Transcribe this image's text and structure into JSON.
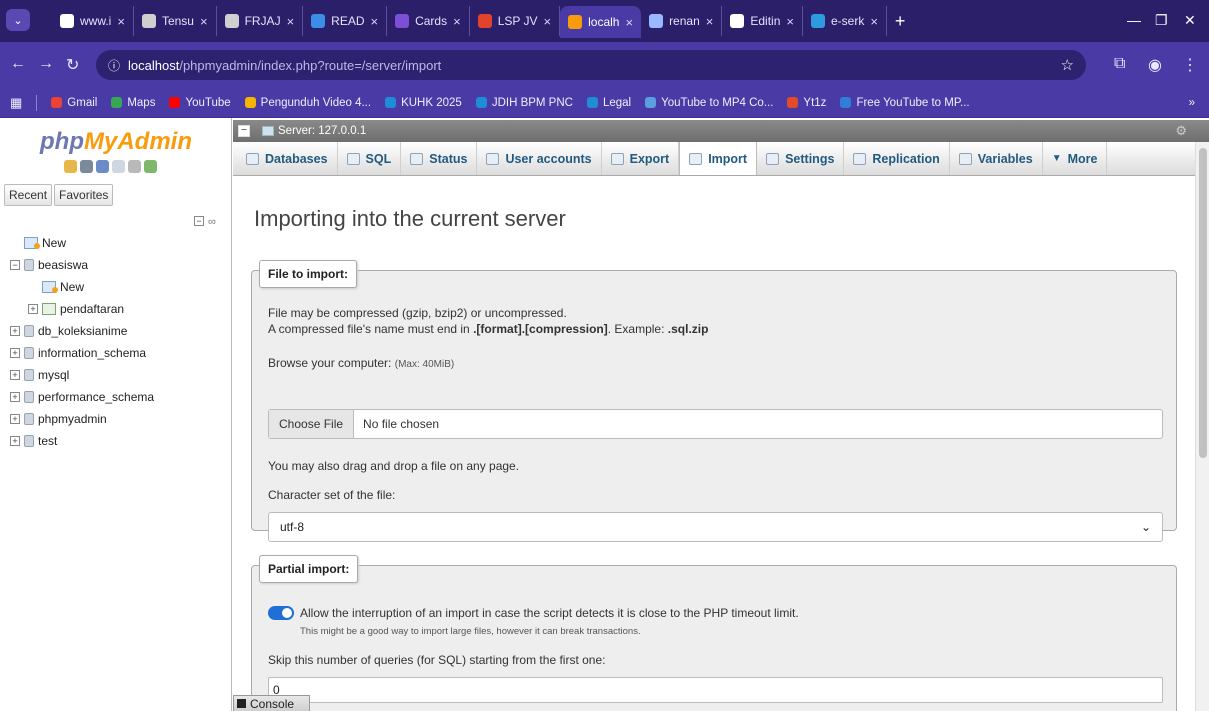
{
  "browser": {
    "tabs": [
      {
        "label": "www.i",
        "color": "#ffffff"
      },
      {
        "label": "Tensu",
        "color": "#cfcfcf"
      },
      {
        "label": "FRJAJ",
        "color": "#cfcfcf"
      },
      {
        "label": "READ",
        "color": "#3a8ee6"
      },
      {
        "label": "Cards",
        "color": "#7b4fd6"
      },
      {
        "label": "LSP JV",
        "color": "#e0442f"
      },
      {
        "label": "localh",
        "color": "#f89c0e"
      },
      {
        "label": "renan",
        "color": "#9ab8ff"
      },
      {
        "label": "Editin",
        "color": "#ffffff"
      },
      {
        "label": "e-serk",
        "color": "#2e9be0"
      }
    ],
    "tab_close": "×",
    "new_tab": "+",
    "url_host": "localhost",
    "url_path": "/phpmyadmin/index.php?route=/server/import",
    "bookmarks": [
      {
        "label": "Gmail",
        "color": "#ea4335"
      },
      {
        "label": "Maps",
        "color": "#34a853"
      },
      {
        "label": "YouTube",
        "color": "#ff0000"
      },
      {
        "label": "Pengunduh Video 4...",
        "color": "#f4b400"
      },
      {
        "label": "KUHK 2025",
        "color": "#1f8dd6"
      },
      {
        "label": "JDIH BPM PNC",
        "color": "#1f8dd6"
      },
      {
        "label": "Legal",
        "color": "#1f8dd6"
      },
      {
        "label": "YouTube to MP4 Co...",
        "color": "#5aa0e0"
      },
      {
        "label": "Yt1z",
        "color": "#e24a2a"
      },
      {
        "label": "Free YouTube to MP...",
        "color": "#2f7fd8"
      }
    ],
    "bookmarks_more": "»"
  },
  "sidebar": {
    "logo_php": "php",
    "logo_myadmin": "MyAdmin",
    "recent_label": "Recent",
    "favorites_label": "Favorites",
    "tree": [
      {
        "label": "New",
        "level": 0,
        "icon": "new"
      },
      {
        "label": "beasiswa",
        "level": 0,
        "icon": "db",
        "expanded": true
      },
      {
        "label": "New",
        "level": 1,
        "icon": "new"
      },
      {
        "label": "pendaftaran",
        "level": 1,
        "icon": "view"
      },
      {
        "label": "db_koleksianime",
        "level": 0,
        "icon": "db"
      },
      {
        "label": "information_schema",
        "level": 0,
        "icon": "db"
      },
      {
        "label": "mysql",
        "level": 0,
        "icon": "db"
      },
      {
        "label": "performance_schema",
        "level": 0,
        "icon": "db"
      },
      {
        "label": "phpmyadmin",
        "level": 0,
        "icon": "db"
      },
      {
        "label": "test",
        "level": 0,
        "icon": "db"
      }
    ]
  },
  "main": {
    "server_label": "Server: 127.0.0.1",
    "tabs": [
      {
        "label": "Databases",
        "active": false
      },
      {
        "label": "SQL",
        "active": false
      },
      {
        "label": "Status",
        "active": false
      },
      {
        "label": "User accounts",
        "active": false
      },
      {
        "label": "Export",
        "active": false
      },
      {
        "label": "Import",
        "active": true
      },
      {
        "label": "Settings",
        "active": false
      },
      {
        "label": "Replication",
        "active": false
      },
      {
        "label": "Variables",
        "active": false
      },
      {
        "label": "More",
        "active": false
      }
    ],
    "title": "Importing into the current server",
    "file_section": {
      "legend": "File to import:",
      "line1": "File may be compressed (gzip, bzip2) or uncompressed.",
      "line2_prefix": "A compressed file's name must end in ",
      "line2_format": ".[format].[compression]",
      "line2_mid": ". Example: ",
      "line2_example": ".sql.zip",
      "browse_label": "Browse your computer:",
      "browse_max": "(Max: 40MiB)",
      "choose_file": "Choose File",
      "no_file": "No file chosen",
      "drag_drop": "You may also drag and drop a file on any page.",
      "charset_label": "Character set of the file:",
      "charset_value": "utf-8"
    },
    "partial_section": {
      "legend": "Partial import:",
      "allow_interrupt": "Allow the interruption of an import in case the script detects it is close to the PHP timeout limit.",
      "allow_note": "This might be a good way to import large files, however it can break transactions.",
      "skip_label": "Skip this number of queries (for SQL) starting from the first one:",
      "skip_value": "0"
    },
    "console_label": "Console"
  }
}
